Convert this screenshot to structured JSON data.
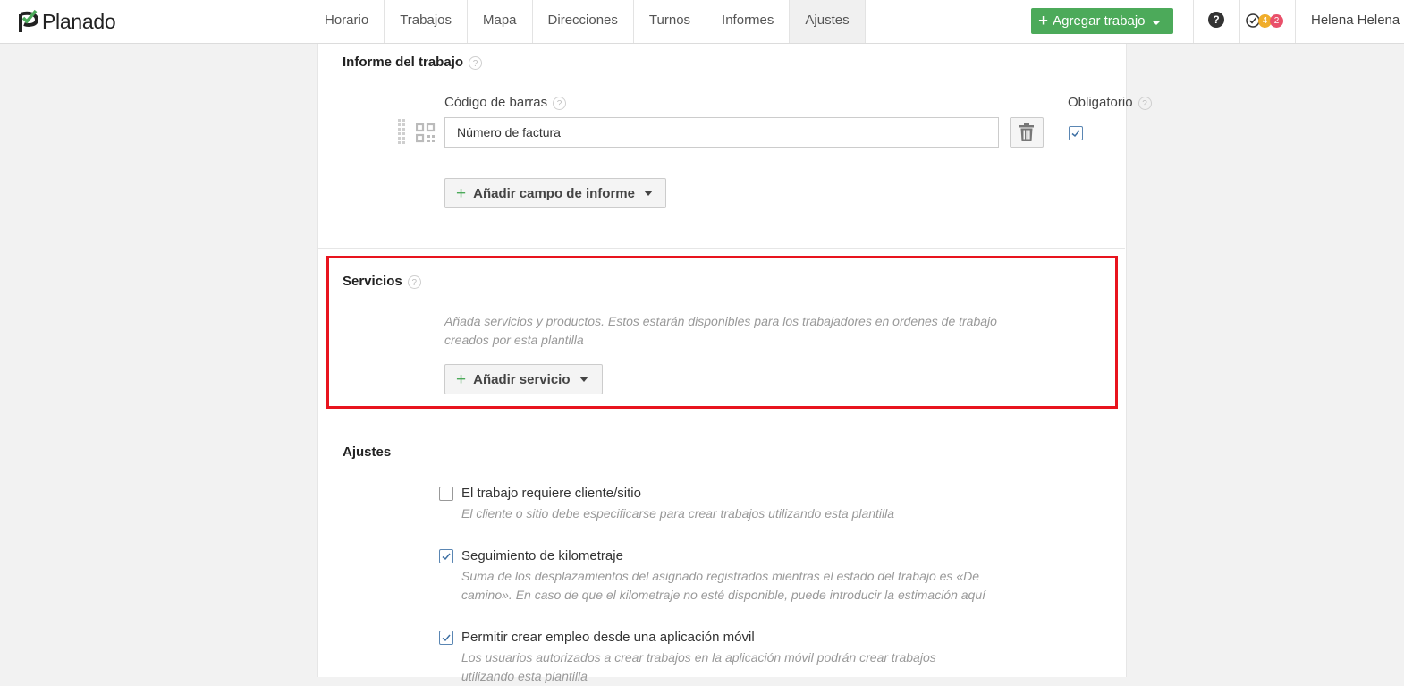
{
  "header": {
    "logo": "Planado",
    "nav": [
      "Horario",
      "Trabajos",
      "Mapa",
      "Direcciones",
      "Turnos",
      "Informes",
      "Ajustes"
    ],
    "active_nav": "Ajustes",
    "add_job_label": "Agregar trabajo",
    "help_label": "?",
    "badge_orange": "4",
    "badge_red": "2",
    "user_name": "Helena Helena"
  },
  "report": {
    "title": "Informe del trabajo",
    "field_label": "Código de barras",
    "required_label": "Obligatorio",
    "field_value": "Número de factura",
    "required_checked": true,
    "add_field_label": "Añadir campo de informe"
  },
  "services": {
    "title": "Servicios",
    "hint_line1": "Añada servicios y productos. Estos estarán disponibles para los trabajadores en ordenes de trabajo",
    "hint_line2": "creados por esta plantilla",
    "add_service_label": "Añadir servicio"
  },
  "settings": {
    "title": "Ajustes",
    "options": [
      {
        "label": "El trabajo requiere cliente/sitio",
        "checked": false,
        "hint1": "El cliente o sitio debe especificarse para crear trabajos utilizando esta plantilla",
        "hint2": ""
      },
      {
        "label": "Seguimiento de kilometraje",
        "checked": true,
        "hint1": "Suma de los desplazamientos del asignado registrados mientras el estado del trabajo es «De",
        "hint2": "camino». En caso de que el kilometraje no esté disponible, puede introducir la estimación aquí"
      },
      {
        "label": "Permitir crear empleo desde una aplicación móvil",
        "checked": true,
        "hint1": "Los usuarios autorizados a crear trabajos en la aplicación móvil podrán crear trabajos",
        "hint2": "utilizando esta plantilla"
      }
    ]
  }
}
